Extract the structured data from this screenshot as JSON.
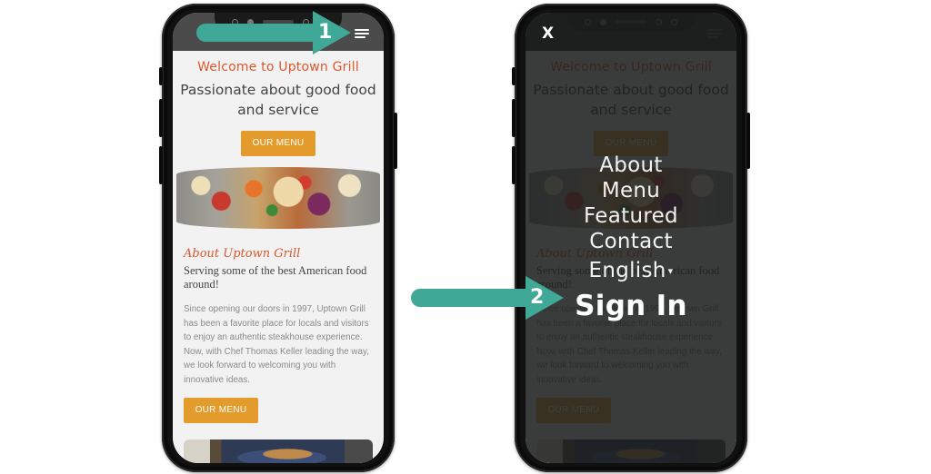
{
  "step1": {
    "callout_number": "1",
    "site": {
      "welcome": "Welcome to Uptown Grill",
      "tagline": "Passionate about good food and service",
      "menu_button": "OUR MENU",
      "about_heading": "About Uptown Grill",
      "about_subheading": "Serving some of the best American food around!",
      "about_body": "Since opening our doors in 1997, Uptown Grill has been a favorite place for locals and visitors to enjoy an authentic steakhouse experience. Now, with Chef Thomas Keller leading the way, we look forward to welcoming you with innovative ideas.",
      "about_button": "OUR MENU"
    },
    "icons": {
      "menu": "hamburger-icon"
    }
  },
  "step2": {
    "callout_number": "2",
    "close_label": "X",
    "nav": {
      "items": [
        {
          "label": "About"
        },
        {
          "label": "Menu"
        },
        {
          "label": "Featured"
        },
        {
          "label": "Contact"
        }
      ],
      "language": {
        "label": "English",
        "caret": "▾"
      },
      "sign_in": "Sign In"
    },
    "site": {
      "welcome": "Welcome to Uptown Grill",
      "tagline": "Passionate about good food and service",
      "menu_button": "OUR MENU",
      "about_heading": "About Uptown Grill",
      "about_subheading": "Serving some of the best American food around!",
      "about_body": "Since opening our doors in 1997, Uptown Grill has been a favorite place for locals and visitors to enjoy an authentic steakhouse experience. Now, with Chef Thomas Keller leading the way, we look forward to welcoming you with innovative ideas.",
      "about_button": "OUR MENU"
    }
  },
  "colors": {
    "accent_orange": "#d9592c",
    "button_gold": "#e39b2c",
    "callout_teal": "#3fa896"
  }
}
